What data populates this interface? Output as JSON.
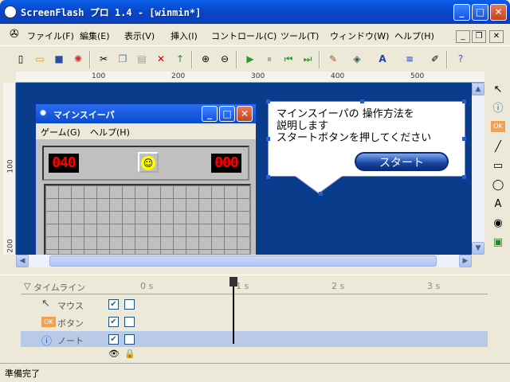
{
  "window": {
    "title": "ScreenFlash プロ 1.4 - [winmin*]"
  },
  "menu": {
    "items": [
      "ファイル(F)",
      "編集(E)",
      "表示(V)",
      "挿入(I)",
      "コントロール(C)",
      "ツール(T)",
      "ウィンドウ(W)",
      "ヘルプ(H)"
    ]
  },
  "ruler": {
    "top": [
      "100",
      "200",
      "300",
      "400",
      "500"
    ],
    "left": [
      "100",
      "200"
    ]
  },
  "minesweeper": {
    "title": "マインスイーパ",
    "menu": [
      "ゲーム(G)",
      "ヘルプ(H)"
    ],
    "mines_left": "040",
    "timer": "000"
  },
  "callout": {
    "text": "マインスイーパの 操作方法を\n説明します\nスタートボタンを押してください",
    "button": "スタート"
  },
  "timeline": {
    "label": "タイムライン",
    "times": [
      "0 s",
      "1 s",
      "2 s",
      "3 s"
    ],
    "rows": [
      {
        "name": "マウス",
        "icon": "cursor-icon",
        "visible": "✔"
      },
      {
        "name": "ボタン",
        "icon": "ok-button-icon",
        "visible": "✔"
      },
      {
        "name": "ノート",
        "icon": "info-icon",
        "visible": "✔"
      }
    ]
  },
  "status": {
    "text": "準備完了"
  },
  "colors": {
    "canvas": "#0a3c8c",
    "titlebar": "#0846c8"
  }
}
